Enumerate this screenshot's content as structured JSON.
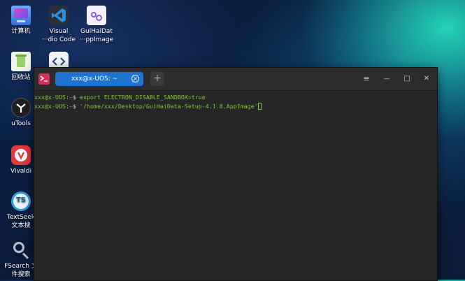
{
  "desktop": {
    "icons": [
      {
        "label": "计算机",
        "icon": "computer-icon"
      },
      {
        "label": "Visual\n···dio Code",
        "label1": "Visual",
        "label2": "···dio Code",
        "icon": "vscode-icon"
      },
      {
        "label1": "GuiHaiDat",
        "label2": "···ppImage",
        "icon": "appimage-icon"
      },
      {
        "label": "回收站",
        "icon": "trash-icon"
      },
      {
        "label": "uTools",
        "icon": "utools-icon"
      },
      {
        "label": "Vivaldi",
        "icon": "vivaldi-icon"
      },
      {
        "label1": "TextSeek",
        "label2": "文本搜",
        "icon": "textseek-icon"
      },
      {
        "label1": "FSearch 文",
        "label2": "件搜索",
        "icon": "fsearch-icon"
      }
    ]
  },
  "terminal": {
    "tab_label": "xxx@x-UOS: ~",
    "tab_close": "×",
    "new_tab": "+",
    "menu_glyph": "≡",
    "min_glyph": "—",
    "max_glyph": "□",
    "close_glyph": "✕",
    "lines": [
      {
        "user": "xxx@x-UOS",
        "path": "~",
        "cmd": "export ELECTRON_DISABLE_SANDBOX=true"
      },
      {
        "user": "xxx@x-UOS",
        "path": "~",
        "cmd": "'/home/xxx/Desktop/GuiHaiData-Setup-4.1.8.AppImage'"
      }
    ]
  },
  "colors": {
    "tab_active": "#1f74d2",
    "prompt_user": "#7fc93b",
    "prompt_path": "#4f8ee8",
    "terminal_bg": "#262626"
  }
}
